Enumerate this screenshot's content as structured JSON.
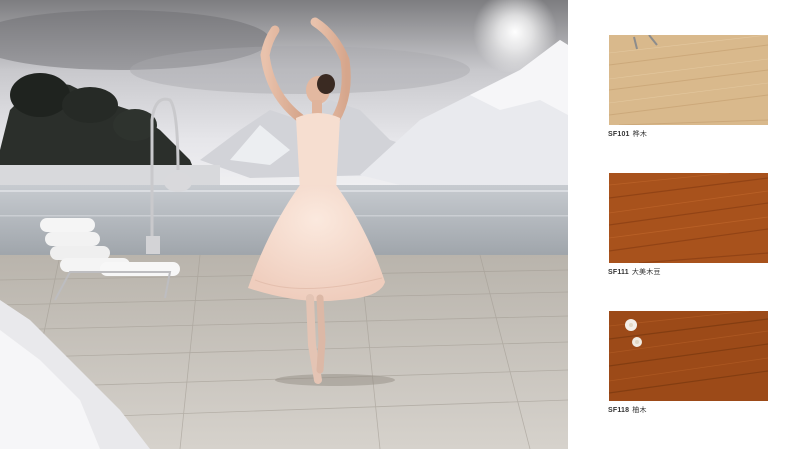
{
  "colors": {
    "panel_bg": "#ffffff",
    "caption_text": "#333333",
    "sf101_wood": "#d9b98c",
    "sf111_wood": "#a8521c",
    "sf118_wood": "#9c4a18"
  },
  "scene": {
    "subject": "ballerina-figure",
    "props": [
      "lounge-chair",
      "arc-floor-lamp"
    ]
  },
  "products": [
    {
      "code": "SF101",
      "name": "桦木"
    },
    {
      "code": "SF111",
      "name": "大美木豆"
    },
    {
      "code": "SF118",
      "name": "柚木"
    }
  ]
}
